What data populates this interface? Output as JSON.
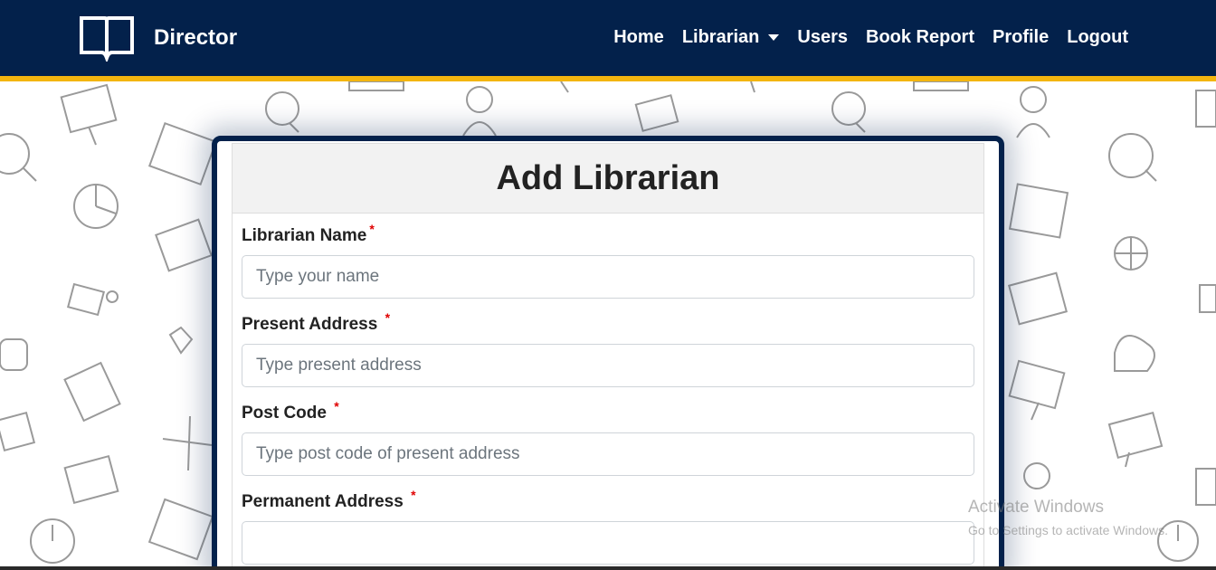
{
  "navbar": {
    "brand": "Director",
    "links": [
      {
        "label": "Home"
      },
      {
        "label": "Librarian"
      },
      {
        "label": "Users"
      },
      {
        "label": "Book Report"
      },
      {
        "label": "Profile"
      },
      {
        "label": "Logout"
      }
    ]
  },
  "form": {
    "title": "Add Librarian",
    "fields": [
      {
        "label": "Librarian Name",
        "required_mark": "*",
        "placeholder": "Type your name",
        "value": ""
      },
      {
        "label": "Present Address",
        "required_mark": "*",
        "placeholder": "Type present address",
        "value": ""
      },
      {
        "label": "Post Code",
        "required_mark": "*",
        "placeholder": "Type post code of present address",
        "value": ""
      },
      {
        "label": "Permanent Address",
        "required_mark": "*",
        "placeholder": "",
        "value": ""
      }
    ]
  },
  "watermark": {
    "title": "Activate Windows",
    "subtitle": "Go to Settings to activate Windows."
  },
  "colors": {
    "navbar": "#03214b",
    "accent": "#f3b50f",
    "required": "#e00000"
  },
  "icons": [
    "book-icon",
    "caret-down-icon"
  ]
}
